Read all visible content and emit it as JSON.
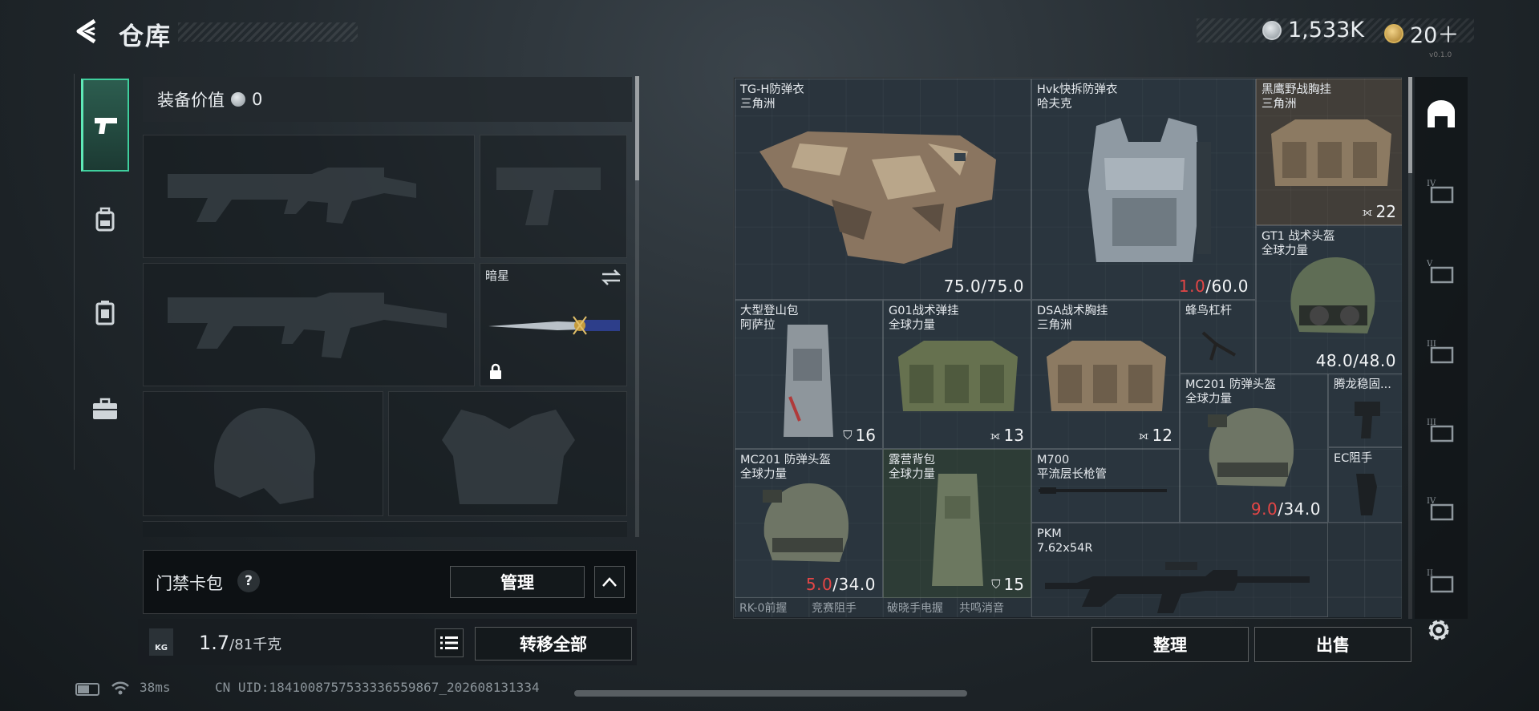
{
  "header": {
    "title": "仓库",
    "currency_silver": "1,533K",
    "currency_gold": "20＋",
    "version_tiny": "v0.1.0"
  },
  "nav": {
    "items": [
      {
        "name": "weapons",
        "icon": "pistol-icon",
        "active": true
      },
      {
        "name": "gear",
        "icon": "backpack-icon",
        "active": false
      },
      {
        "name": "consumables",
        "icon": "canister-icon",
        "active": false
      },
      {
        "name": "cases",
        "icon": "briefcase-icon",
        "active": false
      }
    ]
  },
  "loadout": {
    "value_label": "装备价值",
    "value": "0",
    "melee_name": "暗星",
    "card_pack_label": "门禁卡包",
    "card_pack_help": "?",
    "manage_label": "管理",
    "weight_current": "1.7",
    "weight_max": "/81千克",
    "weight_badge": "KG",
    "transfer_all_label": "转移全部"
  },
  "inventory": {
    "items": [
      {
        "id": "tgh",
        "name": "TG-H防弹衣",
        "sub": "三角洲",
        "durability": "75.0",
        "max": "/75.0"
      },
      {
        "id": "hvk",
        "name": "Hvk快拆防弹衣",
        "sub": "哈夫克",
        "durability": "1.0",
        "max": "/60.0",
        "low": true
      },
      {
        "id": "heiying",
        "name": "黑鹰野战胸挂",
        "sub": "三角洲",
        "count": "22"
      },
      {
        "id": "gt1",
        "name": "GT1 战术头盔",
        "sub": "全球力量",
        "durability": "48.0",
        "max": "/48.0"
      },
      {
        "id": "dengshan",
        "name": "大型登山包",
        "sub": "阿萨拉",
        "count": "16"
      },
      {
        "id": "g01",
        "name": "G01战术弹挂",
        "sub": "全球力量",
        "count": "13"
      },
      {
        "id": "dsa",
        "name": "DSA战术胸挂",
        "sub": "三角洲",
        "count": "12"
      },
      {
        "id": "fengniao",
        "name": "蜂鸟杠杆",
        "sub": ""
      },
      {
        "id": "mc201a",
        "name": "MC201 防弹头盔",
        "sub": "全球力量",
        "durability": "9.0",
        "max": "/34.0",
        "low": true
      },
      {
        "id": "tenglong",
        "name": "腾龙稳固...",
        "sub": ""
      },
      {
        "id": "ec",
        "name": "EC阻手",
        "sub": ""
      },
      {
        "id": "mc201b",
        "name": "MC201 防弹头盔",
        "sub": "全球力量",
        "durability": "5.0",
        "max": "/34.0",
        "low": true
      },
      {
        "id": "luying",
        "name": "露营背包",
        "sub": "全球力量",
        "count": "15"
      },
      {
        "id": "m700",
        "name": "M700",
        "sub": "平流层长枪管"
      },
      {
        "id": "pkm",
        "name": "PKM",
        "sub": "7.62x54R"
      }
    ],
    "partial_row": [
      "RK-0前握",
      "竞赛阻手",
      "破晓手电握",
      "共鸣消音"
    ]
  },
  "actions": {
    "sort_label": "整理",
    "sell_label": "出售"
  },
  "status": {
    "ping": "38ms",
    "uid": "CN UID:1841008757533336559867_202608131334"
  },
  "colors": {
    "accent": "#3fcf9d",
    "low_durability": "#e54646"
  }
}
